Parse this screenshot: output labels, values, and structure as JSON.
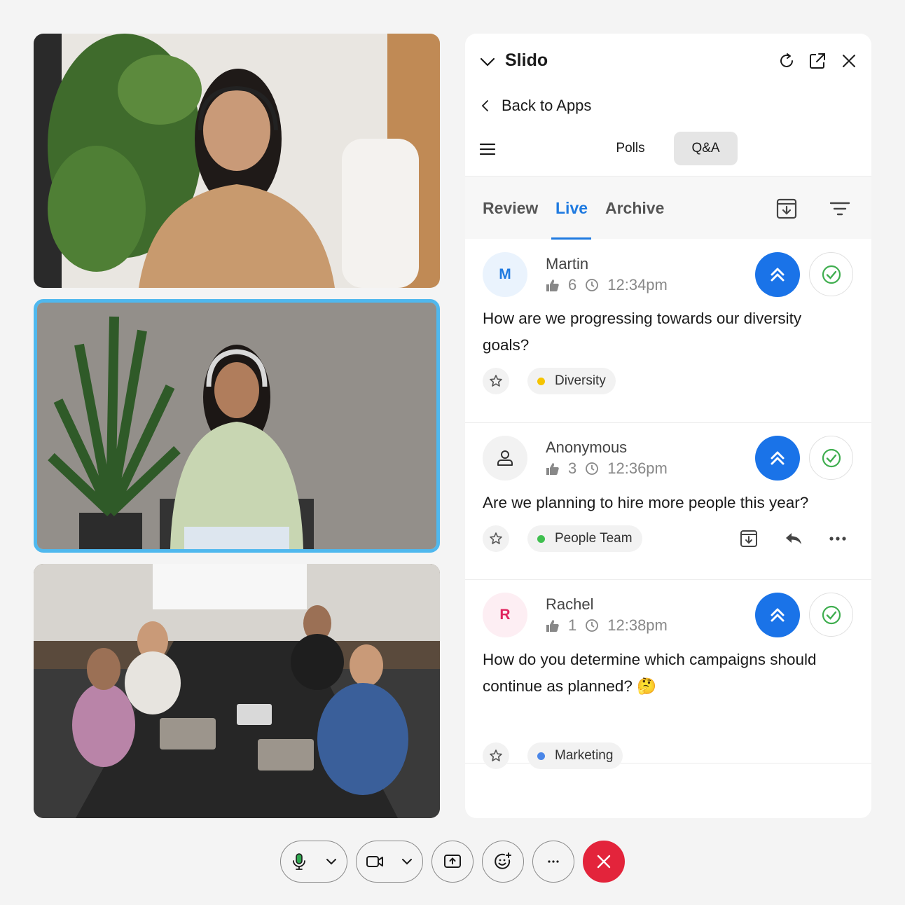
{
  "panel": {
    "title": "Slido",
    "back_label": "Back to Apps",
    "segments": [
      "Polls",
      "Q&A"
    ],
    "active_segment": "Q&A",
    "tabs": [
      "Review",
      "Live",
      "Archive"
    ],
    "active_tab": "Live"
  },
  "questions": [
    {
      "avatar": "M",
      "name": "Martin",
      "likes": "6",
      "time": "12:34pm",
      "text": "How are we progressing towards our diversity goals?",
      "tag": "Diversity",
      "tag_color": "#f5c400",
      "avatar_color": "#1f7ae0",
      "avatar_bg": "#eaf3fd"
    },
    {
      "avatar": "person-icon",
      "name": "Anonymous",
      "likes": "3",
      "time": "12:36pm",
      "text": "Are we planning to hire more people this year?",
      "tag": "People Team",
      "tag_color": "#3fbf4f",
      "avatar_bg": "#f2f2f2"
    },
    {
      "avatar": "R",
      "name": "Rachel",
      "likes": "1",
      "time": "12:38pm",
      "text": "How do you determine which campaigns should continue as planned? 🤔",
      "tag": "Marketing",
      "tag_color": "#4a86e8",
      "avatar_color": "#e0245e",
      "avatar_bg": "#fdeef3"
    }
  ],
  "colors": {
    "accent": "#1f7ae0",
    "upvote": "#1a73e8",
    "approve": "#3fae4f",
    "end_call": "#e3243b",
    "active_tile_border": "#4fb8ee"
  },
  "toolbar": {
    "buttons": [
      "microphone-icon",
      "camera-icon",
      "share-screen-icon",
      "reactions-icon",
      "more-icon",
      "end-call-icon"
    ]
  }
}
